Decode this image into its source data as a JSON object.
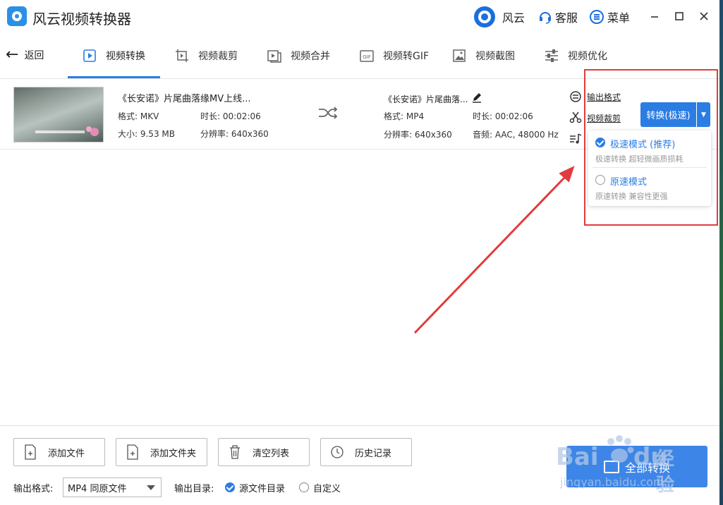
{
  "app": {
    "title": "风云视频转换器"
  },
  "titlebar": {
    "fengyun": "风云",
    "service": "客服",
    "menu": "菜单"
  },
  "nav": {
    "back": "返回",
    "tabs": [
      "视频转换",
      "视频裁剪",
      "视频合并",
      "视频转GIF",
      "视频截图",
      "视频优化"
    ],
    "active_tab": "视频转换"
  },
  "file": {
    "source": {
      "title": "《长安诺》片尾曲落缘MV上线...",
      "format": "格式: MKV",
      "duration": "时长: 00:02:06",
      "size": "大小: 9.53 MB",
      "resolution": "分辨率: 640x360"
    },
    "output": {
      "title": "《长安诺》片尾曲落...",
      "format": "格式: MP4",
      "duration": "时长: 00:02:06",
      "resolution": "分辨率: 640x360",
      "audio": "音频: AAC, 48000 Hz"
    },
    "side_links": {
      "output_format": "输出格式",
      "video_cut": "视频裁剪"
    },
    "convert_button": "转换(极速)"
  },
  "dropdown": {
    "items": [
      {
        "label": "极速模式 (推荐)",
        "desc": "极速转换 超轻微画质损耗",
        "checked": true
      },
      {
        "label": "原速模式",
        "desc": "原速转换 兼容性更强",
        "checked": false
      }
    ]
  },
  "bottom": {
    "buttons": [
      "添加文件",
      "添加文件夹",
      "清空列表",
      "历史记录"
    ],
    "output_format_label": "输出格式:",
    "output_format_value": "MP4 同原文件",
    "output_dir_label": "输出目录:",
    "dir_options": [
      "源文件目录",
      "自定义"
    ],
    "convert_all": "全部转换"
  },
  "watermark": {
    "brand": "Bai",
    "du": "du",
    "jingyan": "经验",
    "url": "jingyan.baidu.com"
  },
  "colors": {
    "accent": "#2b7de3",
    "highlight": "#e23b3b"
  }
}
